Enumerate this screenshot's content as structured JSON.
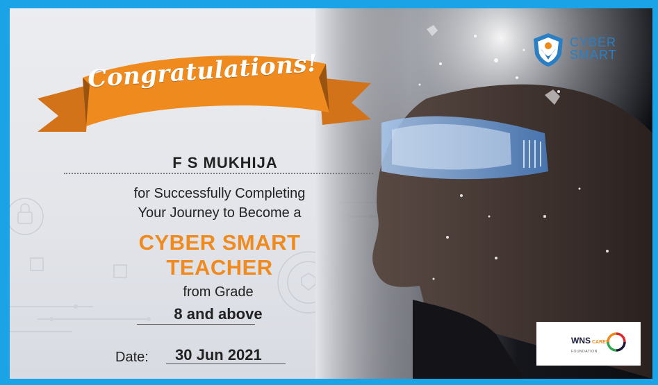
{
  "ribbon": {
    "text": "Congratulations!"
  },
  "recipient": {
    "name": "F S MUKHIJA"
  },
  "message": {
    "line1": "for Successfully Completing",
    "line2": "Your Journey to Become a"
  },
  "title": {
    "line1": "CYBER SMART",
    "line2": "TEACHER"
  },
  "grade": {
    "label": "from Grade",
    "value": "8 and above"
  },
  "date": {
    "label": "Date:",
    "value": "30 Jun 2021"
  },
  "logo": {
    "line1": "CYBER",
    "line2": "SMART"
  },
  "sponsor": {
    "name": "WNS",
    "cares": "CARES",
    "tagline": "FOUNDATION"
  },
  "colors": {
    "accent": "#ef8a1e",
    "frame": "#1aa3e6",
    "logo_blue": "#2a7fc4"
  }
}
